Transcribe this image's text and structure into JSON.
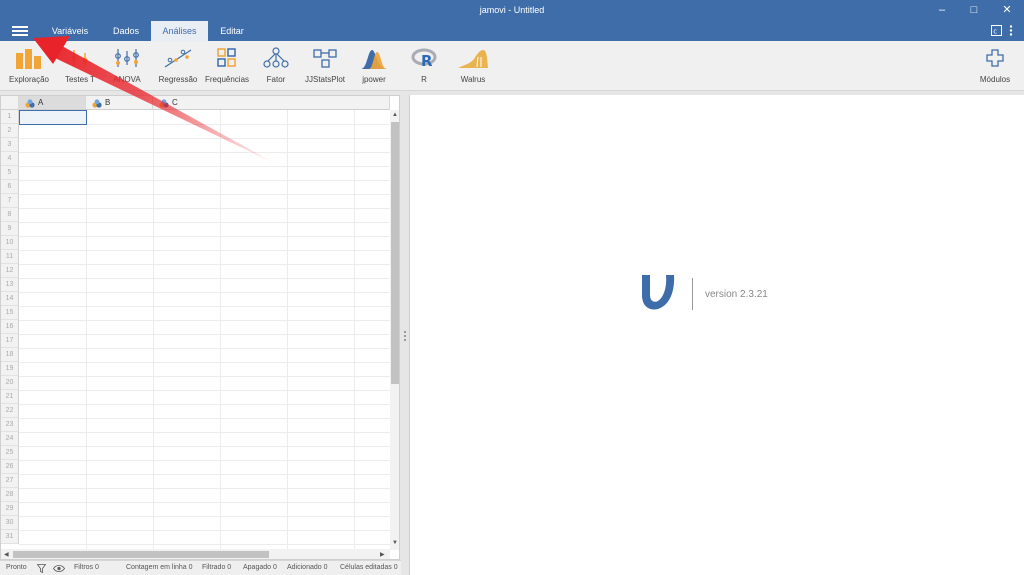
{
  "window": {
    "title": "jamovi - Untitled"
  },
  "tabs": [
    {
      "label": "Variáveis"
    },
    {
      "label": "Dados"
    },
    {
      "label": "Análises"
    },
    {
      "label": "Editar"
    }
  ],
  "active_tab": "Análises",
  "ribbon": {
    "items": [
      {
        "label": "Exploração",
        "icon": "exploration-icon"
      },
      {
        "label": "Testes T",
        "icon": "ttest-icon"
      },
      {
        "label": "ANOVA",
        "icon": "anova-icon"
      },
      {
        "label": "Regressão",
        "icon": "regression-icon"
      },
      {
        "label": "Frequências",
        "icon": "frequencies-icon"
      },
      {
        "label": "Fator",
        "icon": "factor-icon"
      },
      {
        "label": "JJStatsPlot",
        "icon": "jjstatsplot-icon"
      },
      {
        "label": "jpower",
        "icon": "jpower-icon"
      },
      {
        "label": "R",
        "icon": "r-icon"
      },
      {
        "label": "Walrus",
        "icon": "walrus-icon"
      }
    ],
    "modules_label": "Módulos"
  },
  "sheet": {
    "columns": [
      "A",
      "B",
      "C"
    ],
    "rows": [
      "1",
      "2",
      "3",
      "4",
      "5",
      "6",
      "7",
      "8",
      "9",
      "10",
      "11",
      "12",
      "13",
      "14",
      "15",
      "16",
      "17",
      "18",
      "19",
      "20",
      "21",
      "22",
      "23",
      "24",
      "25",
      "26",
      "27",
      "28",
      "29",
      "30",
      "31"
    ]
  },
  "results": {
    "version": "version 2.3.21"
  },
  "status": {
    "ready": "Pronto",
    "filters": "Filtros 0",
    "row_count": "Contagem em linha 0",
    "filtered": "Filtrado 0",
    "deleted": "Apagado 0",
    "added": "Adicionado 0",
    "edited": "Células editadas 0"
  },
  "colors": {
    "accent": "#3e6da9",
    "annotation": "#e8232a"
  }
}
